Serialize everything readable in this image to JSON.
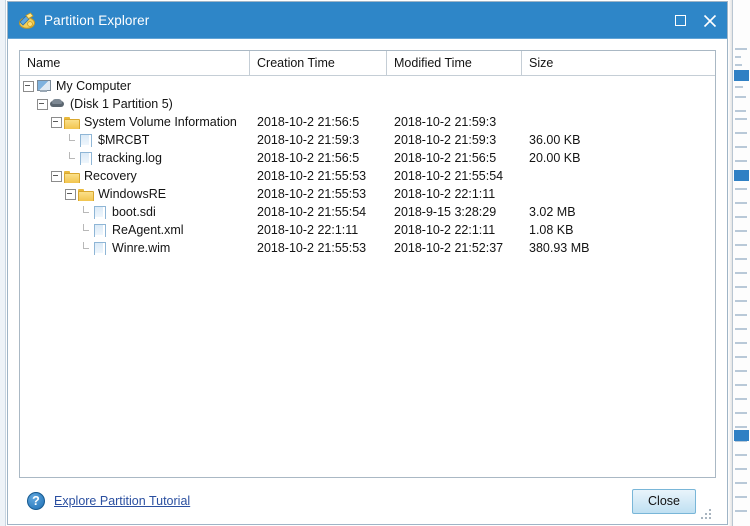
{
  "window": {
    "title": "Partition Explorer",
    "icon": "partition-explorer-icon",
    "maximize_label": "□",
    "close_label": "✕"
  },
  "listview": {
    "columns": [
      {
        "key": "name",
        "label": "Name"
      },
      {
        "key": "ctime",
        "label": "Creation Time"
      },
      {
        "key": "mtime",
        "label": "Modified Time"
      },
      {
        "key": "size",
        "label": "Size"
      }
    ],
    "rows": [
      {
        "name": "My Computer",
        "icon": "computer-icon",
        "depth": 0,
        "expander": "collapse",
        "ctime": "",
        "mtime": "",
        "size": ""
      },
      {
        "name": "(Disk 1 Partition 5)",
        "icon": "disk-icon",
        "depth": 1,
        "expander": "collapse",
        "ctime": "",
        "mtime": "",
        "size": ""
      },
      {
        "name": "System Volume Information",
        "icon": "folder-icon",
        "depth": 2,
        "expander": "collapse",
        "ctime": "2018-10-2 21:56:5",
        "mtime": "2018-10-2 21:59:3",
        "size": ""
      },
      {
        "name": "$MRCBT",
        "icon": "file-icon",
        "depth": 3,
        "expander": "leaf",
        "ctime": "2018-10-2 21:59:3",
        "mtime": "2018-10-2 21:59:3",
        "size": "36.00 KB"
      },
      {
        "name": "tracking.log",
        "icon": "file-icon",
        "depth": 3,
        "expander": "leaf-last",
        "ctime": "2018-10-2 21:56:5",
        "mtime": "2018-10-2 21:56:5",
        "size": "20.00 KB"
      },
      {
        "name": "Recovery",
        "icon": "folder-icon",
        "depth": 2,
        "expander": "collapse",
        "ctime": "2018-10-2 21:55:53",
        "mtime": "2018-10-2 21:55:54",
        "size": ""
      },
      {
        "name": "WindowsRE",
        "icon": "folder-icon",
        "depth": 3,
        "expander": "collapse",
        "ctime": "2018-10-2 21:55:53",
        "mtime": "2018-10-2 22:1:11",
        "size": ""
      },
      {
        "name": "boot.sdi",
        "icon": "file-icon",
        "depth": 4,
        "expander": "leaf",
        "ctime": "2018-10-2 21:55:54",
        "mtime": "2018-9-15 3:28:29",
        "size": "3.02 MB"
      },
      {
        "name": "ReAgent.xml",
        "icon": "file-icon",
        "depth": 4,
        "expander": "leaf",
        "ctime": "2018-10-2 22:1:11",
        "mtime": "2018-10-2 22:1:11",
        "size": "1.08 KB"
      },
      {
        "name": "Winre.wim",
        "icon": "file-icon",
        "depth": 4,
        "expander": "leaf-last",
        "ctime": "2018-10-2 21:55:53",
        "mtime": "2018-10-2 21:52:37",
        "size": "380.93 MB"
      }
    ]
  },
  "footer": {
    "help_icon": "help-icon",
    "help_glyph": "?",
    "tutorial_link": "Explore Partition Tutorial",
    "close_label": "Close"
  },
  "colors": {
    "titlebar": "#2e86c8",
    "link": "#2a4fa0",
    "folder": "#f2c44e",
    "button": "#bfe0f2"
  }
}
